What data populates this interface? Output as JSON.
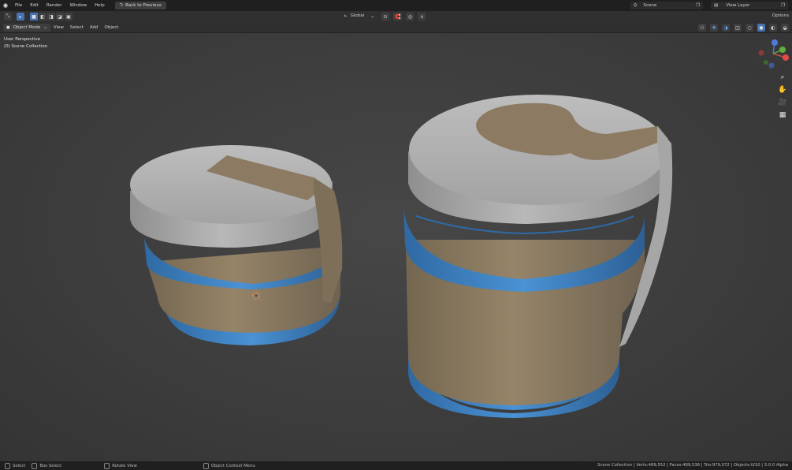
{
  "menu": {
    "items": [
      "File",
      "Edit",
      "Render",
      "Window",
      "Help"
    ],
    "back_button": "Back to Previous",
    "scene": "Scene",
    "view_layer": "View Layer"
  },
  "toolbar": {
    "orientation": "Global",
    "options": "Options"
  },
  "header": {
    "mode": "Object Mode",
    "items": [
      "View",
      "Select",
      "Add",
      "Object"
    ]
  },
  "viewport": {
    "perspective": "User Perspective",
    "collection": "(0) Scene Collection",
    "colors": {
      "lid": "#a9a9a9",
      "blue_plastic": "#3b82c4",
      "label": "#8c7b62"
    }
  },
  "gizmo": {
    "axes": [
      "X",
      "Y",
      "Z"
    ],
    "colors": {
      "x": "#e24a4a",
      "y": "#5fae3e",
      "z": "#4c7cd6",
      "neg": "#8a3a3a"
    }
  },
  "statusbar": {
    "select": "Select",
    "box_select": "Box Select",
    "rotate_view": "Rotate View",
    "context_menu": "Object Context Menu",
    "stats": "Scene Collection | Verts:489,552 | Faces:489,536 | Tris:979,072 | Objects:0/10 | 3.0.0 Alpha"
  }
}
